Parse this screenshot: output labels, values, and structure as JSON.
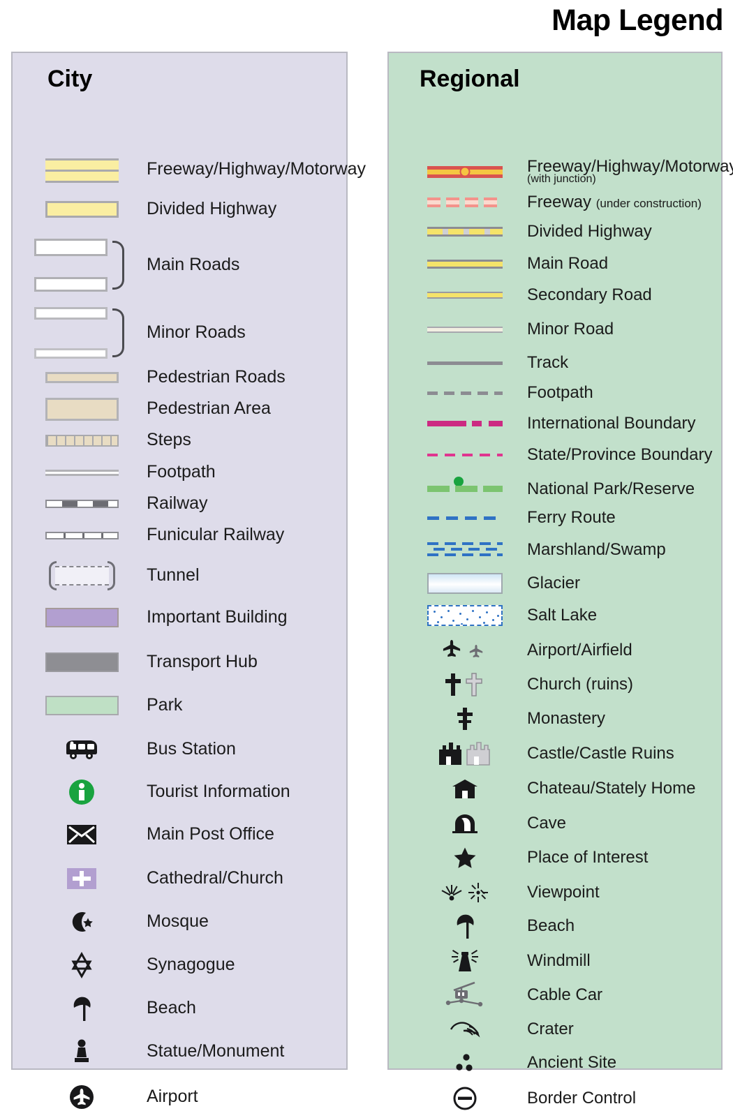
{
  "title": "Map Legend",
  "panels": {
    "city": {
      "heading": "City",
      "background": "#dedcea",
      "items": [
        {
          "label": "Freeway/Highway/Motorway",
          "symbol": "city-freeway"
        },
        {
          "label": "Divided Highway",
          "symbol": "city-divided-highway"
        },
        {
          "label": "Main Roads",
          "symbol": "city-main-roads-braced-pair"
        },
        {
          "label": "Minor Roads",
          "symbol": "city-minor-roads-braced-pair"
        },
        {
          "label": "Pedestrian Roads",
          "symbol": "city-pedestrian-road"
        },
        {
          "label": "Pedestrian Area",
          "symbol": "city-pedestrian-area"
        },
        {
          "label": "Steps",
          "symbol": "city-steps"
        },
        {
          "label": "Footpath",
          "symbol": "city-footpath"
        },
        {
          "label": "Railway",
          "symbol": "city-railway"
        },
        {
          "label": "Funicular Railway",
          "symbol": "city-funicular-railway"
        },
        {
          "label": "Tunnel",
          "symbol": "city-tunnel"
        },
        {
          "label": "Important Building",
          "symbol": "city-important-building"
        },
        {
          "label": "Transport Hub",
          "symbol": "city-transport-hub"
        },
        {
          "label": "Park",
          "symbol": "city-park"
        },
        {
          "label": "Bus Station",
          "symbol": "bus-icon"
        },
        {
          "label": "Tourist Information",
          "symbol": "tourist-information-icon"
        },
        {
          "label": "Main Post Office",
          "symbol": "envelope-icon"
        },
        {
          "label": "Cathedral/Church",
          "symbol": "cathedral-cross-icon"
        },
        {
          "label": "Mosque",
          "symbol": "mosque-star-crescent-icon"
        },
        {
          "label": "Synagogue",
          "symbol": "star-of-david-icon"
        },
        {
          "label": "Beach",
          "symbol": "beach-parasol-icon"
        },
        {
          "label": "Statue/Monument",
          "symbol": "statue-icon"
        },
        {
          "label": "Airport",
          "symbol": "airport-plane-icon"
        }
      ]
    },
    "regional": {
      "heading": "Regional",
      "background": "#c2e0cb",
      "items": [
        {
          "label": "Freeway/Highway/Motorway",
          "sublabel": "(with junction)",
          "symbol": "regional-freeway-with-junction"
        },
        {
          "label": "Freeway",
          "inline_note": "(under construction)",
          "symbol": "regional-freeway-under-construction"
        },
        {
          "label": "Divided Highway",
          "symbol": "regional-divided-highway"
        },
        {
          "label": "Main Road",
          "symbol": "regional-main-road"
        },
        {
          "label": "Secondary Road",
          "symbol": "regional-secondary-road"
        },
        {
          "label": "Minor Road",
          "symbol": "regional-minor-road"
        },
        {
          "label": "Track",
          "symbol": "regional-track"
        },
        {
          "label": "Footpath",
          "symbol": "regional-footpath"
        },
        {
          "label": "International Boundary",
          "symbol": "regional-international-boundary"
        },
        {
          "label": "State/Province Boundary",
          "symbol": "regional-state-boundary"
        },
        {
          "label": "National Park/Reserve",
          "symbol": "regional-national-park"
        },
        {
          "label": "Ferry Route",
          "symbol": "regional-ferry-route"
        },
        {
          "label": "Marshland/Swamp",
          "symbol": "regional-marshland"
        },
        {
          "label": "Glacier",
          "symbol": "regional-glacier"
        },
        {
          "label": "Salt Lake",
          "symbol": "regional-salt-lake"
        },
        {
          "label": "Airport/Airfield",
          "symbol": "airport-airfield-icon"
        },
        {
          "label": "Church (ruins)",
          "symbol": "church-ruins-cross-icon"
        },
        {
          "label": "Monastery",
          "symbol": "monastery-cross-icon"
        },
        {
          "label": "Castle/Castle Ruins",
          "symbol": "castle-icon"
        },
        {
          "label": "Chateau/Stately Home",
          "symbol": "chateau-icon"
        },
        {
          "label": "Cave",
          "symbol": "cave-icon"
        },
        {
          "label": "Place of Interest",
          "symbol": "star-icon"
        },
        {
          "label": "Viewpoint",
          "symbol": "viewpoint-icon"
        },
        {
          "label": "Beach",
          "symbol": "beach-parasol-icon"
        },
        {
          "label": "Windmill",
          "symbol": "windmill-icon"
        },
        {
          "label": "Cable Car",
          "symbol": "cable-car-icon"
        },
        {
          "label": "Crater",
          "symbol": "crater-icon"
        },
        {
          "label": "Ancient Site",
          "symbol": "ancient-site-icon"
        },
        {
          "label": "Border Control",
          "symbol": "border-control-icon"
        }
      ]
    }
  },
  "colors": {
    "city_panel": "#dedcea",
    "regional_panel": "#c2e0cb",
    "panel_border": "#b9b9c2",
    "highway_yellow": "#faeea2",
    "road_yellow": "#f5e36a",
    "freeway_red": "#d9534f",
    "junction_amber": "#f5c542",
    "pedestrian_tan": "#e8dcc3",
    "important_building_purple": "#b29fd0",
    "transport_hub_grey": "#8e8e93",
    "park_green": "#bfe0c5",
    "tourist_info_green": "#19a33f",
    "boundary_magenta": "#cc2a82",
    "state_boundary_pink": "#e0358f",
    "national_park_green": "#7cc470",
    "ferry_blue": "#2f72c4",
    "glacier_blue": "#cfe5f5",
    "text": "#1b1b1b"
  }
}
